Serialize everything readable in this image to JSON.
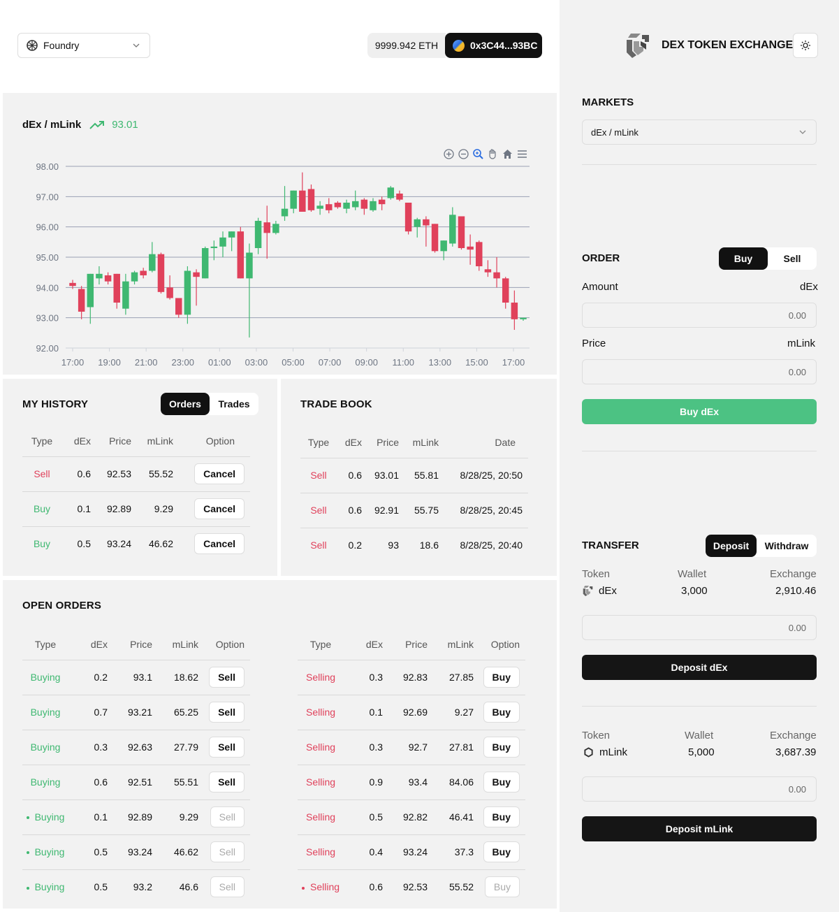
{
  "header": {
    "network": "Foundry",
    "balance": "9999.942 ETH",
    "account": "0x3C44...93BC",
    "brand": "DEX TOKEN EXCHANGE"
  },
  "chart": {
    "pair": "dEx / mLink",
    "last_price": "93.01",
    "toolbar_icons": [
      "zoom-in-icon",
      "zoom-out-icon",
      "magnifier-icon",
      "pan-icon",
      "home-icon",
      "menu-icon"
    ]
  },
  "chart_data": {
    "type": "candlestick",
    "title": "",
    "ylim": [
      92,
      98
    ],
    "y_ticks": [
      "98.00",
      "97.00",
      "96.00",
      "95.00",
      "94.00",
      "93.00",
      "92.00"
    ],
    "x_ticks": [
      "17:00",
      "19:00",
      "21:00",
      "23:00",
      "01:00",
      "03:00",
      "05:00",
      "07:00",
      "09:00",
      "11:00",
      "13:00",
      "15:00",
      "17:00"
    ],
    "up_color": "#3fb871",
    "down_color": "#e0415b",
    "candles": [
      {
        "o": 94.15,
        "h": 94.25,
        "l": 93.95,
        "c": 94.05
      },
      {
        "o": 93.95,
        "h": 94.05,
        "l": 92.95,
        "c": 93.2
      },
      {
        "o": 93.35,
        "h": 94.45,
        "l": 92.8,
        "c": 94.45
      },
      {
        "o": 94.3,
        "h": 94.7,
        "l": 94.1,
        "c": 94.45
      },
      {
        "o": 94.4,
        "h": 94.5,
        "l": 94.1,
        "c": 94.2
      },
      {
        "o": 94.45,
        "h": 94.45,
        "l": 93.3,
        "c": 93.5
      },
      {
        "o": 93.3,
        "h": 94.45,
        "l": 93.1,
        "c": 94.2
      },
      {
        "o": 94.2,
        "h": 94.55,
        "l": 94.1,
        "c": 94.5
      },
      {
        "o": 94.55,
        "h": 94.65,
        "l": 94.3,
        "c": 94.4
      },
      {
        "o": 94.55,
        "h": 95.5,
        "l": 94.5,
        "c": 95.1
      },
      {
        "o": 95.1,
        "h": 95.15,
        "l": 93.8,
        "c": 93.85
      },
      {
        "o": 94.0,
        "h": 94.4,
        "l": 93.6,
        "c": 93.65
      },
      {
        "o": 93.65,
        "h": 93.65,
        "l": 93.0,
        "c": 93.1
      },
      {
        "o": 93.1,
        "h": 94.7,
        "l": 92.8,
        "c": 94.55
      },
      {
        "o": 94.5,
        "h": 94.6,
        "l": 93.4,
        "c": 94.35
      },
      {
        "o": 94.3,
        "h": 95.35,
        "l": 94.3,
        "c": 95.3
      },
      {
        "o": 95.3,
        "h": 95.55,
        "l": 94.9,
        "c": 95.35
      },
      {
        "o": 95.35,
        "h": 95.85,
        "l": 95.0,
        "c": 95.65
      },
      {
        "o": 95.65,
        "h": 95.85,
        "l": 95.2,
        "c": 95.85
      },
      {
        "o": 95.85,
        "h": 96.0,
        "l": 94.3,
        "c": 94.3
      },
      {
        "o": 94.3,
        "h": 95.45,
        "l": 92.35,
        "c": 95.15
      },
      {
        "o": 95.3,
        "h": 96.3,
        "l": 95.1,
        "c": 96.2
      },
      {
        "o": 96.15,
        "h": 96.7,
        "l": 94.95,
        "c": 95.8
      },
      {
        "o": 95.8,
        "h": 96.2,
        "l": 95.75,
        "c": 96.1
      },
      {
        "o": 96.35,
        "h": 97.35,
        "l": 96.2,
        "c": 96.6
      },
      {
        "o": 96.6,
        "h": 97.2,
        "l": 96.45,
        "c": 97.2
      },
      {
        "o": 97.2,
        "h": 97.8,
        "l": 96.5,
        "c": 96.5
      },
      {
        "o": 97.25,
        "h": 97.4,
        "l": 96.5,
        "c": 96.55
      },
      {
        "o": 96.6,
        "h": 96.85,
        "l": 96.4,
        "c": 96.7
      },
      {
        "o": 96.75,
        "h": 96.95,
        "l": 96.45,
        "c": 96.55
      },
      {
        "o": 96.8,
        "h": 96.85,
        "l": 96.6,
        "c": 96.65
      },
      {
        "o": 96.6,
        "h": 96.9,
        "l": 96.45,
        "c": 96.8
      },
      {
        "o": 96.65,
        "h": 97.2,
        "l": 96.55,
        "c": 96.85
      },
      {
        "o": 96.9,
        "h": 96.95,
        "l": 96.4,
        "c": 96.6
      },
      {
        "o": 96.55,
        "h": 96.95,
        "l": 96.5,
        "c": 96.85
      },
      {
        "o": 96.9,
        "h": 97.0,
        "l": 96.55,
        "c": 96.75
      },
      {
        "o": 96.95,
        "h": 97.35,
        "l": 96.9,
        "c": 97.3
      },
      {
        "o": 97.1,
        "h": 97.2,
        "l": 96.85,
        "c": 96.9
      },
      {
        "o": 96.8,
        "h": 96.8,
        "l": 95.75,
        "c": 95.85
      },
      {
        "o": 96.0,
        "h": 96.3,
        "l": 95.65,
        "c": 96.25
      },
      {
        "o": 96.25,
        "h": 96.35,
        "l": 95.35,
        "c": 96.05
      },
      {
        "o": 96.1,
        "h": 96.1,
        "l": 95.15,
        "c": 95.2
      },
      {
        "o": 95.2,
        "h": 95.55,
        "l": 94.9,
        "c": 95.55
      },
      {
        "o": 95.45,
        "h": 96.65,
        "l": 95.35,
        "c": 96.4
      },
      {
        "o": 96.35,
        "h": 96.35,
        "l": 95.25,
        "c": 95.3
      },
      {
        "o": 95.35,
        "h": 95.75,
        "l": 94.75,
        "c": 95.25
      },
      {
        "o": 95.5,
        "h": 95.55,
        "l": 94.55,
        "c": 94.7
      },
      {
        "o": 94.6,
        "h": 94.9,
        "l": 94.35,
        "c": 94.5
      },
      {
        "o": 94.5,
        "h": 95.0,
        "l": 94.0,
        "c": 94.3
      },
      {
        "o": 94.3,
        "h": 94.35,
        "l": 93.3,
        "c": 93.5
      },
      {
        "o": 93.5,
        "h": 93.9,
        "l": 92.6,
        "c": 92.95
      },
      {
        "o": 92.95,
        "h": 93.0,
        "l": 92.9,
        "c": 93.0
      }
    ]
  },
  "history": {
    "title": "MY HISTORY",
    "tabs": [
      "Orders",
      "Trades"
    ],
    "columns": [
      "Type",
      "dEx",
      "Price",
      "mLink",
      "Option"
    ],
    "rows": [
      {
        "type": "Sell",
        "dex": "0.6",
        "price": "92.53",
        "mlink": "55.52",
        "option": "Cancel"
      },
      {
        "type": "Buy",
        "dex": "0.1",
        "price": "92.89",
        "mlink": "9.29",
        "option": "Cancel"
      },
      {
        "type": "Buy",
        "dex": "0.5",
        "price": "93.24",
        "mlink": "46.62",
        "option": "Cancel"
      }
    ]
  },
  "tradebook": {
    "title": "TRADE BOOK",
    "columns": [
      "Type",
      "dEx",
      "Price",
      "mLink",
      "Date"
    ],
    "rows": [
      {
        "type": "Sell",
        "dex": "0.6",
        "price": "93.01",
        "mlink": "55.81",
        "date": "8/28/25, 20:50"
      },
      {
        "type": "Sell",
        "dex": "0.6",
        "price": "92.91",
        "mlink": "55.75",
        "date": "8/28/25, 20:45"
      },
      {
        "type": "Sell",
        "dex": "0.2",
        "price": "93",
        "mlink": "18.6",
        "date": "8/28/25, 20:40"
      }
    ]
  },
  "open_orders": {
    "title": "OPEN ORDERS",
    "columns": [
      "Type",
      "dEx",
      "Price",
      "mLink",
      "Option"
    ],
    "buying": [
      {
        "type": "Buying",
        "dex": "0.2",
        "price": "93.1",
        "mlink": "18.62",
        "option": "Sell",
        "mine": false
      },
      {
        "type": "Buying",
        "dex": "0.7",
        "price": "93.21",
        "mlink": "65.25",
        "option": "Sell",
        "mine": false
      },
      {
        "type": "Buying",
        "dex": "0.3",
        "price": "92.63",
        "mlink": "27.79",
        "option": "Sell",
        "mine": false
      },
      {
        "type": "Buying",
        "dex": "0.6",
        "price": "92.51",
        "mlink": "55.51",
        "option": "Sell",
        "mine": false
      },
      {
        "type": "Buying",
        "dex": "0.1",
        "price": "92.89",
        "mlink": "9.29",
        "option": "Sell",
        "mine": true
      },
      {
        "type": "Buying",
        "dex": "0.5",
        "price": "93.24",
        "mlink": "46.62",
        "option": "Sell",
        "mine": true
      },
      {
        "type": "Buying",
        "dex": "0.5",
        "price": "93.2",
        "mlink": "46.6",
        "option": "Sell",
        "mine": true
      }
    ],
    "selling": [
      {
        "type": "Selling",
        "dex": "0.3",
        "price": "92.83",
        "mlink": "27.85",
        "option": "Buy",
        "mine": false
      },
      {
        "type": "Selling",
        "dex": "0.1",
        "price": "92.69",
        "mlink": "9.27",
        "option": "Buy",
        "mine": false
      },
      {
        "type": "Selling",
        "dex": "0.3",
        "price": "92.7",
        "mlink": "27.81",
        "option": "Buy",
        "mine": false
      },
      {
        "type": "Selling",
        "dex": "0.9",
        "price": "93.4",
        "mlink": "84.06",
        "option": "Buy",
        "mine": false
      },
      {
        "type": "Selling",
        "dex": "0.5",
        "price": "92.82",
        "mlink": "46.41",
        "option": "Buy",
        "mine": false
      },
      {
        "type": "Selling",
        "dex": "0.4",
        "price": "93.24",
        "mlink": "37.3",
        "option": "Buy",
        "mine": false
      },
      {
        "type": "Selling",
        "dex": "0.6",
        "price": "92.53",
        "mlink": "55.52",
        "option": "Buy",
        "mine": true
      }
    ]
  },
  "markets": {
    "title": "MARKETS",
    "selected": "dEx / mLink"
  },
  "order": {
    "title": "ORDER",
    "tabs": [
      "Buy",
      "Sell"
    ],
    "amount_label": "Amount",
    "amount_unit": "dEx",
    "amount_placeholder": "0.00",
    "price_label": "Price",
    "price_unit": "mLink",
    "price_placeholder": "0.00",
    "submit": "Buy dEx"
  },
  "transfer": {
    "title": "TRANSFER",
    "tabs": [
      "Deposit",
      "Withdraw"
    ],
    "col_token": "Token",
    "col_wallet": "Wallet",
    "col_exchange": "Exchange",
    "token1": {
      "name": "dEx",
      "wallet": "3,000",
      "exchange": "2,910.46",
      "placeholder": "0.00",
      "button": "Deposit dEx"
    },
    "token2": {
      "name": "mLink",
      "wallet": "5,000",
      "exchange": "3,687.39",
      "placeholder": "0.00",
      "button": "Deposit mLink"
    }
  }
}
